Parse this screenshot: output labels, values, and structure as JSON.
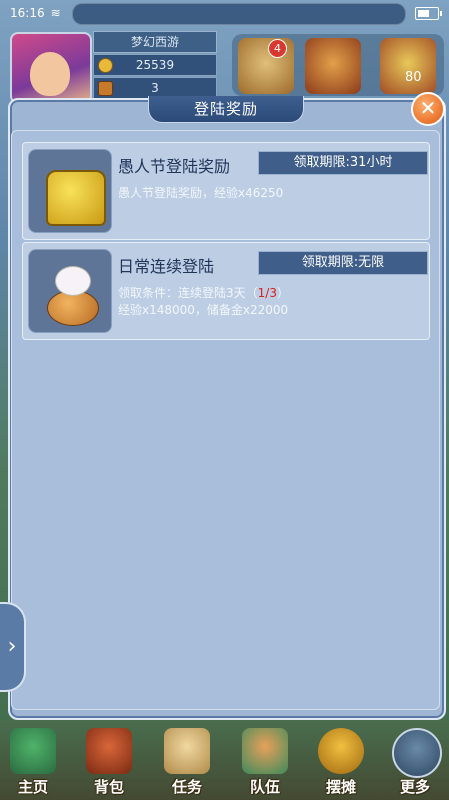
{
  "status_bar": {
    "time": "16:16"
  },
  "player": {
    "name": "梦幻西游",
    "gold": "25539",
    "gems": "3",
    "level": "80",
    "notification_count": "4"
  },
  "dialog": {
    "title": "登陆奖励",
    "close_label": "✕",
    "rewards": [
      {
        "title": "愚人节登陆奖励",
        "deadline": "领取期限:31小时",
        "desc_line1": "愚人节登陆奖励，经验x46250"
      },
      {
        "title": "日常连续登陆",
        "deadline": "领取期限:无限",
        "desc_line1_prefix": "领取条件：连续登陆3天（",
        "progress": "1/3",
        "desc_line1_suffix": "）",
        "desc_line2": "经验x148000，储备金x22000"
      }
    ]
  },
  "bottom_nav": [
    {
      "label": "主页"
    },
    {
      "label": "背包"
    },
    {
      "label": "任务"
    },
    {
      "label": "队伍"
    },
    {
      "label": "摆摊"
    },
    {
      "label": "更多"
    }
  ],
  "side_arrow": "›"
}
